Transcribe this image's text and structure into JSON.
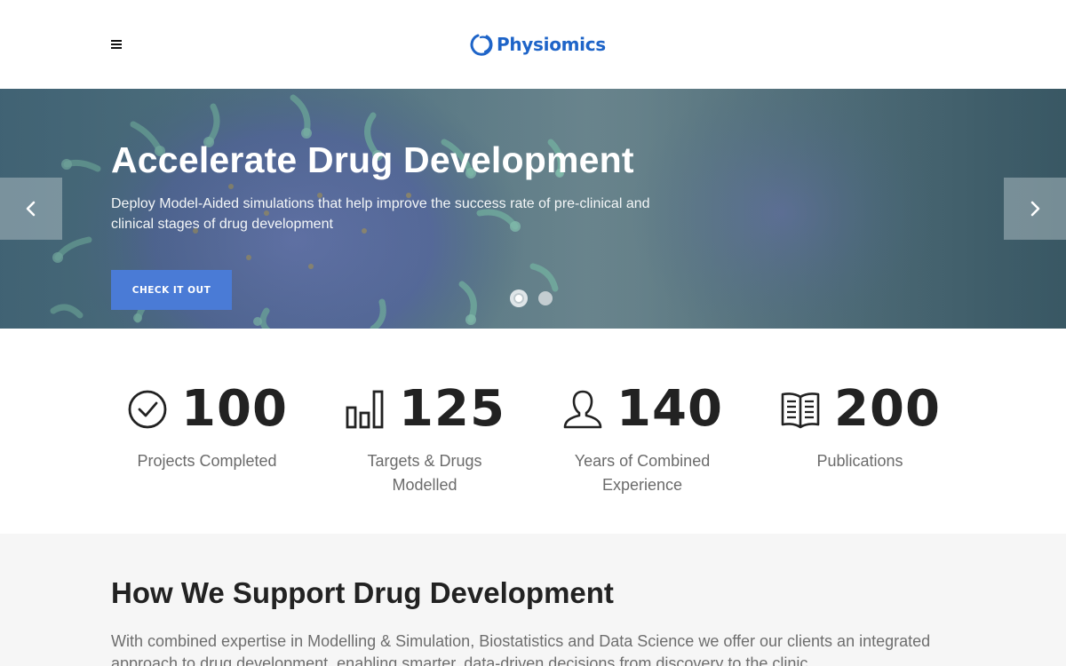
{
  "header": {
    "menu_icon": "hamburger-menu-icon",
    "logo_icon": "physiomics-logo-mark",
    "logo_text": "Physiomics",
    "brand_color": "#1e64c8"
  },
  "hero": {
    "title": "Accelerate Drug Development",
    "subtitle": "Deploy Model-Aided simulations that help improve the success rate of pre-clinical and clinical stages of drug development",
    "cta_label": "CHECK IT OUT",
    "cta_color": "#4a7bd6",
    "prev_icon": "chevron-left-icon",
    "next_icon": "chevron-right-icon",
    "slides_total": 2,
    "active_slide": 1
  },
  "stats": [
    {
      "icon": "check-circle-icon",
      "value": "100",
      "label": "Projects Completed"
    },
    {
      "icon": "bar-chart-icon",
      "value": "125",
      "label": "Targets & Drugs Modelled"
    },
    {
      "icon": "user-icon",
      "value": "140",
      "label": "Years of Combined Experience"
    },
    {
      "icon": "book-icon",
      "value": "200",
      "label": "Publications"
    }
  ],
  "support": {
    "title": "How We Support Drug Development",
    "text": "With combined expertise in Modelling & Simulation, Biostatistics and Data Science we offer our clients an integrated approach to drug development, enabling smarter, data-driven decisions from discovery to the clinic."
  }
}
